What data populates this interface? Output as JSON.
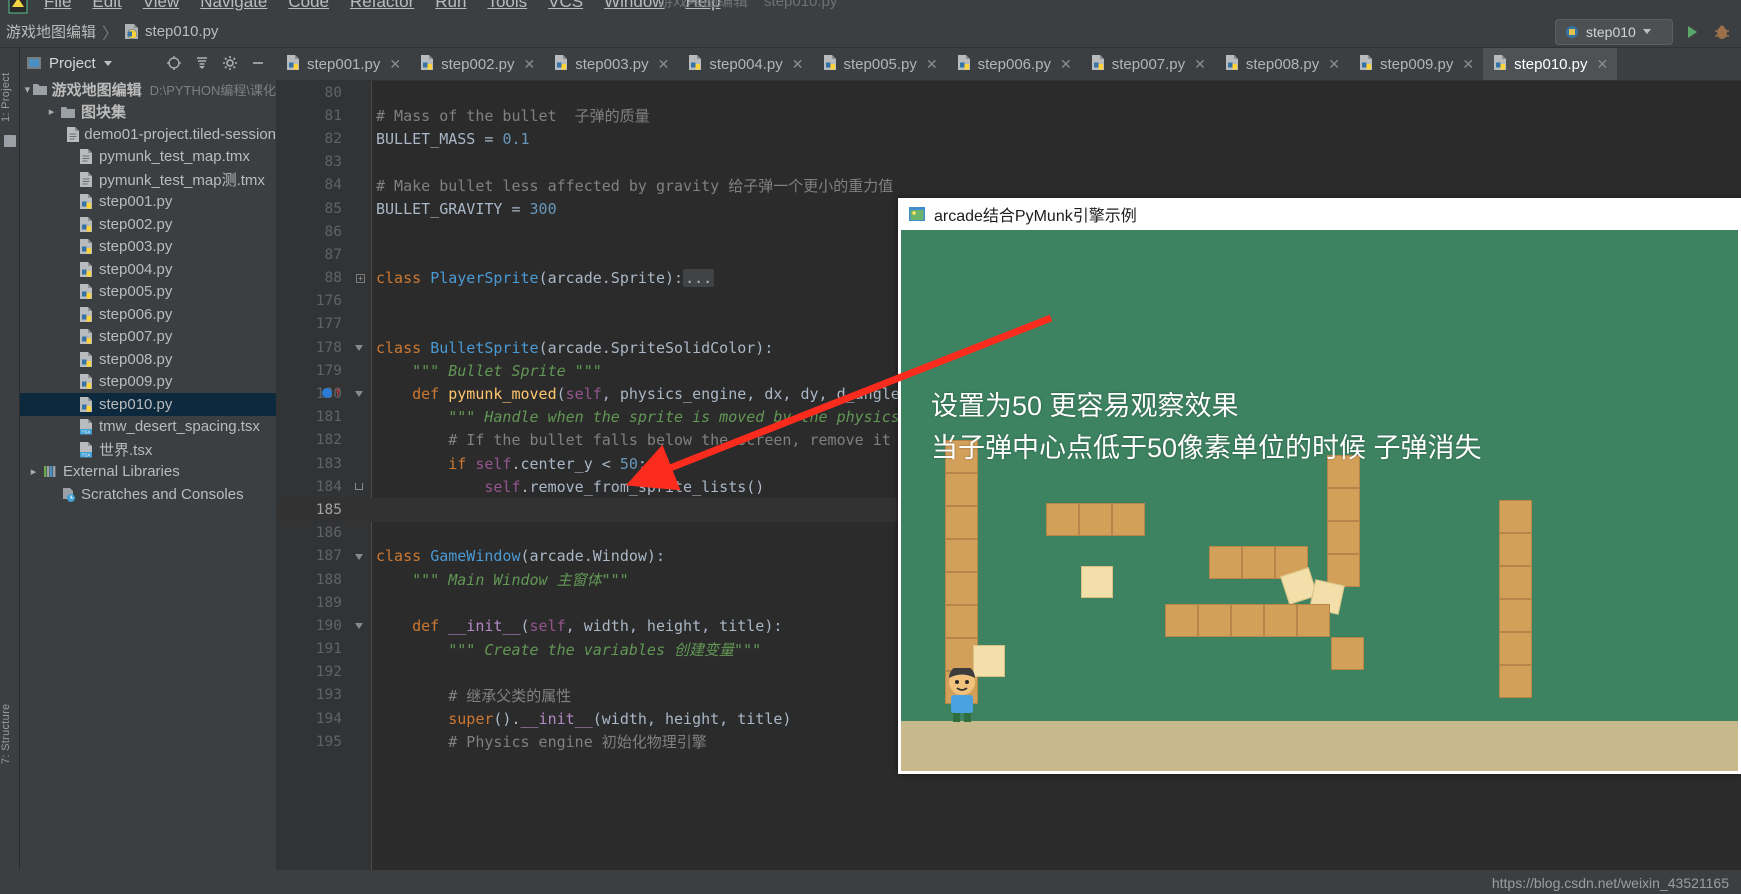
{
  "menu": {
    "items": [
      "File",
      "Edit",
      "View",
      "Navigate",
      "Code",
      "Refactor",
      "Run",
      "Tools",
      "VCS",
      "Window",
      "Help"
    ],
    "far_items": [
      "游戏地图编辑",
      "step010.py"
    ],
    "logo_icon": "pycharm-logo-icon"
  },
  "navbar": {
    "project_crumb": "游戏地图编辑",
    "separator": "〉",
    "file_crumb": "step010.py",
    "file_icon": "python-file-icon",
    "run_config": "step010",
    "run_config_icon": "python-run-config-icon",
    "dropdown_icon": "chevron-down-icon",
    "run_icon": "run-button-icon",
    "debug_icon": "debug-button-icon"
  },
  "left_strip": {
    "project_tab": "1: Project",
    "structure_tab": "7: Structure",
    "favorites_icon": "favorites-icon"
  },
  "project_panel": {
    "title": "Project",
    "title_icon": "project-view-icon",
    "dropdown_icon": "chevron-down-icon",
    "locate_icon": "locate-target-icon",
    "collapse_icon": "collapse-all-icon",
    "settings_icon": "gear-icon",
    "hide_icon": "minimize-icon",
    "tree": [
      {
        "label": "游戏地图编辑",
        "sub": "D:\\PYTHON编程\\课化",
        "icon": "folder-icon",
        "arrow": "expanded",
        "indent": 0,
        "bold": true,
        "selected": false
      },
      {
        "label": "图块集",
        "sub": "",
        "icon": "folder-icon",
        "arrow": "collapsed",
        "indent": 1,
        "bold": true,
        "selected": false
      },
      {
        "label": "demo01-project.tiled-session",
        "sub": "",
        "icon": "text-file-icon",
        "arrow": "none",
        "indent": 2,
        "bold": false,
        "selected": false
      },
      {
        "label": "pymunk_test_map.tmx",
        "sub": "",
        "icon": "text-file-icon",
        "arrow": "none",
        "indent": 2,
        "bold": false,
        "selected": false
      },
      {
        "label": "pymunk_test_map测.tmx",
        "sub": "",
        "icon": "text-file-icon",
        "arrow": "none",
        "indent": 2,
        "bold": false,
        "selected": false
      },
      {
        "label": "step001.py",
        "sub": "",
        "icon": "python-file-icon",
        "arrow": "none",
        "indent": 2,
        "bold": false,
        "selected": false
      },
      {
        "label": "step002.py",
        "sub": "",
        "icon": "python-file-icon",
        "arrow": "none",
        "indent": 2,
        "bold": false,
        "selected": false
      },
      {
        "label": "step003.py",
        "sub": "",
        "icon": "python-file-icon",
        "arrow": "none",
        "indent": 2,
        "bold": false,
        "selected": false
      },
      {
        "label": "step004.py",
        "sub": "",
        "icon": "python-file-icon",
        "arrow": "none",
        "indent": 2,
        "bold": false,
        "selected": false
      },
      {
        "label": "step005.py",
        "sub": "",
        "icon": "python-file-icon",
        "arrow": "none",
        "indent": 2,
        "bold": false,
        "selected": false
      },
      {
        "label": "step006.py",
        "sub": "",
        "icon": "python-file-icon",
        "arrow": "none",
        "indent": 2,
        "bold": false,
        "selected": false
      },
      {
        "label": "step007.py",
        "sub": "",
        "icon": "python-file-icon",
        "arrow": "none",
        "indent": 2,
        "bold": false,
        "selected": false
      },
      {
        "label": "step008.py",
        "sub": "",
        "icon": "python-file-icon",
        "arrow": "none",
        "indent": 2,
        "bold": false,
        "selected": false
      },
      {
        "label": "step009.py",
        "sub": "",
        "icon": "python-file-icon",
        "arrow": "none",
        "indent": 2,
        "bold": false,
        "selected": false
      },
      {
        "label": "step010.py",
        "sub": "",
        "icon": "python-file-icon",
        "arrow": "none",
        "indent": 2,
        "bold": false,
        "selected": true
      },
      {
        "label": "tmw_desert_spacing.tsx",
        "sub": "",
        "icon": "tsx-file-icon",
        "arrow": "none",
        "indent": 2,
        "bold": false,
        "selected": false
      },
      {
        "label": "世界.tsx",
        "sub": "",
        "icon": "tsx-file-icon",
        "arrow": "none",
        "indent": 2,
        "bold": false,
        "selected": false
      },
      {
        "label": "External Libraries",
        "sub": "",
        "icon": "libraries-icon",
        "arrow": "collapsed",
        "indent": 0,
        "bold": false,
        "selected": false
      },
      {
        "label": "Scratches and Consoles",
        "sub": "",
        "icon": "scratches-icon",
        "arrow": "none",
        "indent": 1,
        "bold": false,
        "selected": false
      }
    ]
  },
  "editor": {
    "tabs": [
      {
        "label": "step001.py",
        "icon": "python-file-icon",
        "active": false,
        "close_icon": "close-icon"
      },
      {
        "label": "step002.py",
        "icon": "python-file-icon",
        "active": false,
        "close_icon": "close-icon"
      },
      {
        "label": "step003.py",
        "icon": "python-file-icon",
        "active": false,
        "close_icon": "close-icon"
      },
      {
        "label": "step004.py",
        "icon": "python-file-icon",
        "active": false,
        "close_icon": "close-icon"
      },
      {
        "label": "step005.py",
        "icon": "python-file-icon",
        "active": false,
        "close_icon": "close-icon"
      },
      {
        "label": "step006.py",
        "icon": "python-file-icon",
        "active": false,
        "close_icon": "close-icon"
      },
      {
        "label": "step007.py",
        "icon": "python-file-icon",
        "active": false,
        "close_icon": "close-icon"
      },
      {
        "label": "step008.py",
        "icon": "python-file-icon",
        "active": false,
        "close_icon": "close-icon"
      },
      {
        "label": "step009.py",
        "icon": "python-file-icon",
        "active": false,
        "close_icon": "close-icon"
      },
      {
        "label": "step010.py",
        "icon": "python-file-icon",
        "active": true,
        "close_icon": "close-icon"
      }
    ],
    "current_line": 185,
    "lines": [
      {
        "n": "80",
        "html": "",
        "fold": "",
        "cur": false
      },
      {
        "n": "81",
        "html": "<span class='tk-com'># Mass of the bullet  子弹的质量</span>",
        "fold": "",
        "cur": false
      },
      {
        "n": "82",
        "html": "<span class='tk-plain'>BULLET_MASS = </span><span class='tk-num'>0.1</span>",
        "fold": "",
        "cur": false
      },
      {
        "n": "83",
        "html": "",
        "fold": "",
        "cur": false
      },
      {
        "n": "84",
        "html": "<span class='tk-com'># Make bullet less affected by gravity 给子弹一个更小的重力值</span>",
        "fold": "",
        "cur": false
      },
      {
        "n": "85",
        "html": "<span class='tk-plain'>BULLET_GRAVITY = </span><span class='tk-num'>300</span>",
        "fold": "",
        "cur": false
      },
      {
        "n": "86",
        "html": "",
        "fold": "",
        "cur": false
      },
      {
        "n": "87",
        "html": "",
        "fold": "",
        "cur": false
      },
      {
        "n": "88",
        "html": "<span class='tk-kw'>class </span><span class='tk-blue'>PlayerSprite</span><span class='tk-plain'>(arcade.Sprite):</span><span class='collapsed-dots'>...</span>",
        "fold": "plus",
        "cur": false
      },
      {
        "n": "176",
        "html": "",
        "fold": "",
        "cur": false
      },
      {
        "n": "177",
        "html": "",
        "fold": "",
        "cur": false
      },
      {
        "n": "178",
        "html": "<span class='tk-kw'>class </span><span class='tk-blue'>BulletSprite</span><span class='tk-plain'>(arcade.SpriteSolidColor):</span>",
        "fold": "tri",
        "cur": false
      },
      {
        "n": "179",
        "html": "    <span class='tk-str'>\"\"\" Bullet Sprite \"\"\"</span>",
        "fold": "",
        "cur": false
      },
      {
        "n": "180",
        "html": "    <span class='tk-kw'>def </span><span class='tk-def'>pymunk_moved</span><span class='tk-plain'>(</span><span class='tk-self'>self</span><span class='tk-plain'>, physics_engine, dx, dy, d_angle):</span>",
        "fold": "tri",
        "cur": false,
        "breakpoint": true
      },
      {
        "n": "181",
        "html": "        <span class='tk-str'>\"\"\" Handle when the sprite is moved by the physics e</span>",
        "fold": "",
        "cur": false
      },
      {
        "n": "182",
        "html": "        <span class='tk-com'># If the bullet falls below the screen, remove it</span>",
        "fold": "",
        "cur": false
      },
      {
        "n": "183",
        "html": "        <span class='tk-kw'>if </span><span class='tk-self'>self</span><span class='tk-plain'>.center_y &lt; </span><span class='tk-num'>50</span><span class='tk-plain'>:</span>",
        "fold": "",
        "cur": false
      },
      {
        "n": "184",
        "html": "            <span class='tk-self'>self</span><span class='tk-plain'>.remove_from_sprite_lists()</span>",
        "fold": "end",
        "cur": false
      },
      {
        "n": "185",
        "html": "",
        "fold": "",
        "cur": true
      },
      {
        "n": "186",
        "html": "",
        "fold": "",
        "cur": false
      },
      {
        "n": "187",
        "html": "<span class='tk-kw'>class </span><span class='tk-blue'>GameWindow</span><span class='tk-plain'>(arcade.Window):</span>",
        "fold": "tri",
        "cur": false
      },
      {
        "n": "188",
        "html": "    <span class='tk-str'>\"\"\" Main Window 主窗体\"\"\"</span>",
        "fold": "",
        "cur": false
      },
      {
        "n": "189",
        "html": "",
        "fold": "",
        "cur": false
      },
      {
        "n": "190",
        "html": "    <span class='tk-kw'>def </span><span class='tk-fn'>__init__</span><span class='tk-plain'>(</span><span class='tk-self'>self</span><span class='tk-plain'>, width, height, title):</span>",
        "fold": "tri",
        "cur": false
      },
      {
        "n": "191",
        "html": "        <span class='tk-str'>\"\"\" Create the variables 创建变量\"\"\"</span>",
        "fold": "",
        "cur": false
      },
      {
        "n": "192",
        "html": "",
        "fold": "",
        "cur": false
      },
      {
        "n": "193",
        "html": "        <span class='tk-com'># 继承父类的属性</span>",
        "fold": "",
        "cur": false
      },
      {
        "n": "194",
        "html": "        <span class='tk-kw'>super</span><span class='tk-plain'>().</span><span class='tk-fn'>__init__</span><span class='tk-plain'>(width, height, title)</span>",
        "fold": "",
        "cur": false
      },
      {
        "n": "195",
        "html": "        <span class='tk-com'># Physics engine 初始化物理引擎</span>",
        "fold": "",
        "cur": false
      }
    ]
  },
  "game_window": {
    "title": "arcade结合PyMunk引擎示例",
    "title_icon": "app-window-icon",
    "annotation_line1": "设置为50 更容易观察效果",
    "annotation_line2": "当子弹中心点低于50像素单位的时候 子弹消失",
    "arrow_color": "#fb2c1e",
    "background_color": "#3d8361",
    "ground_color": "#c8b98c",
    "brick_color": "#d3a05a",
    "crate_color": "#f2dfa9"
  },
  "status_bar": {
    "watermark": "https://blog.csdn.net/weixin_43521165"
  }
}
